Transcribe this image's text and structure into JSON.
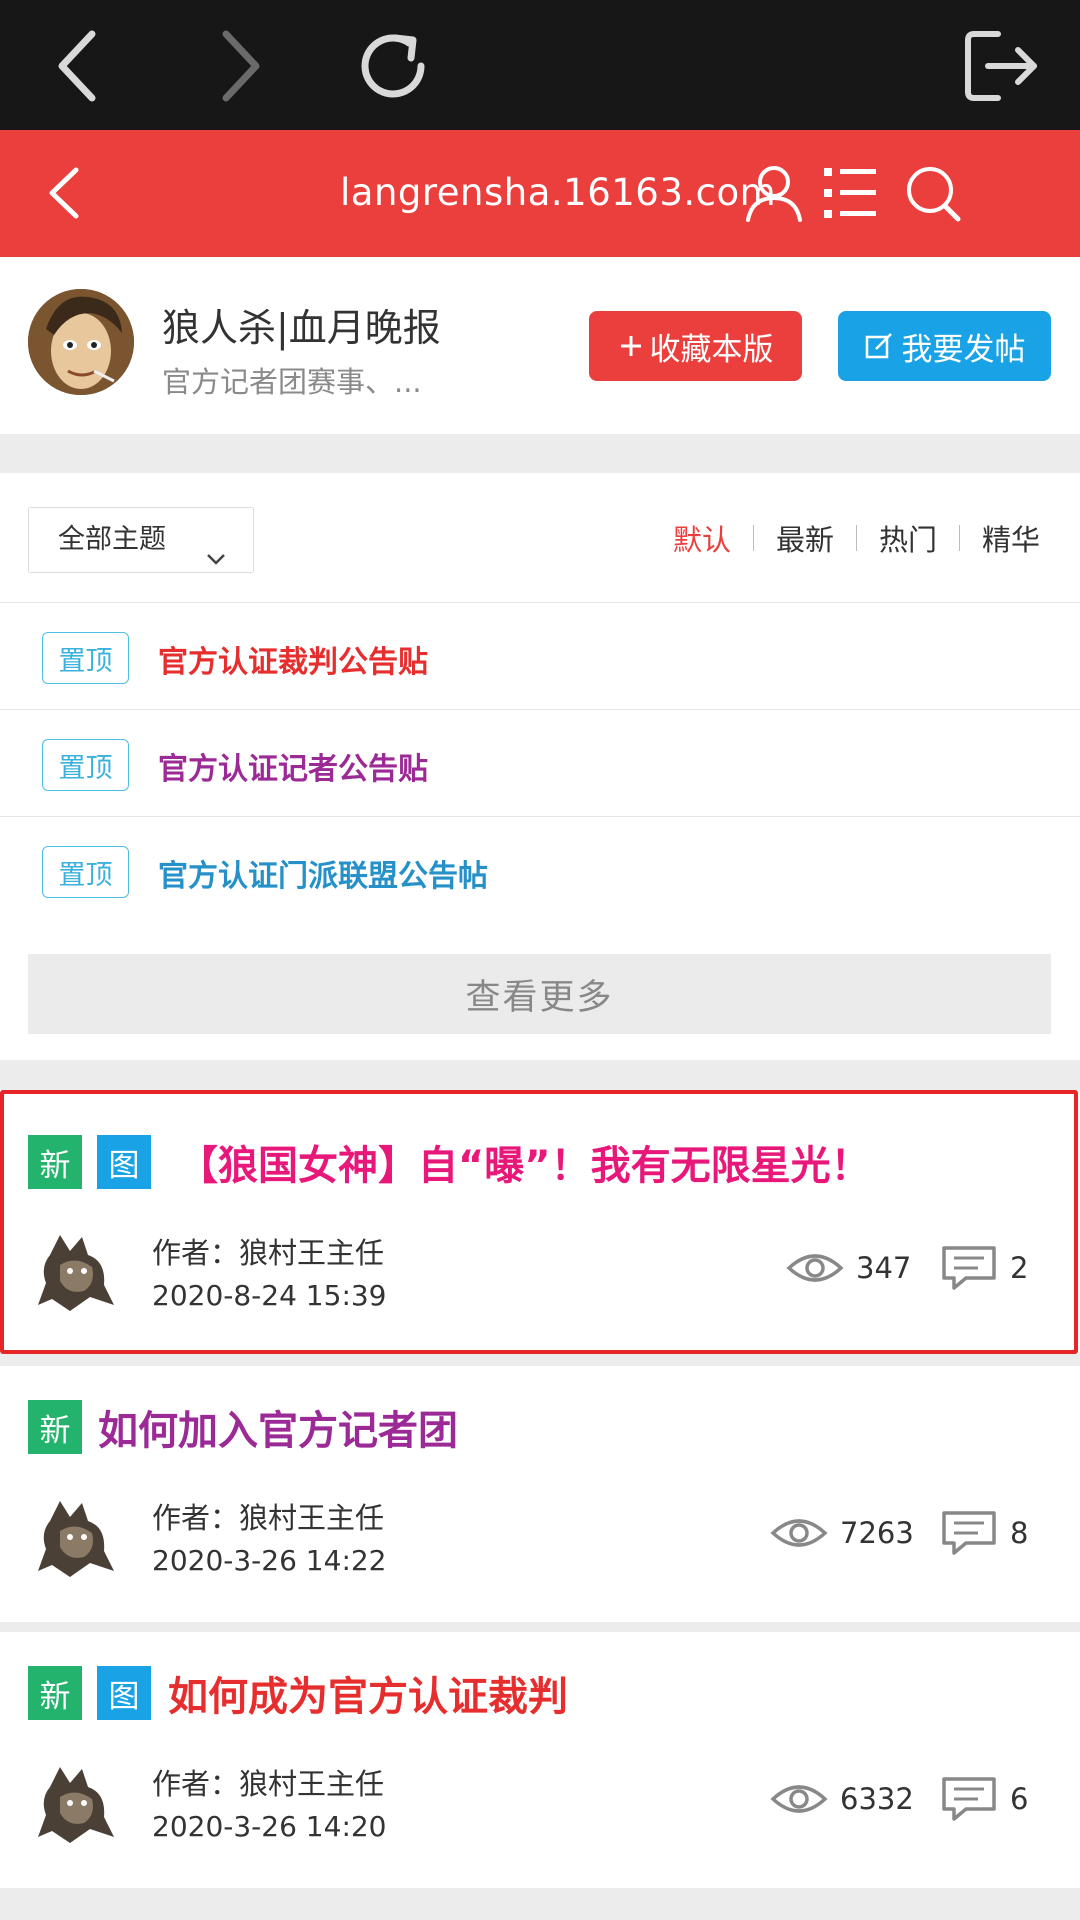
{
  "header": {
    "url": "langrensha.16163.com"
  },
  "forum": {
    "title": "狼人杀|血月晚报",
    "description": "官方记者团赛事、...",
    "favorite_label": "收藏本版",
    "post_label": "我要发帖"
  },
  "filter": {
    "selected_topic": "全部主题",
    "sort_tabs": [
      "默认",
      "最新",
      "热门",
      "精华"
    ],
    "active_sort": "默认"
  },
  "pinned": [
    {
      "badge": "置顶",
      "title": "官方认证裁判公告贴",
      "color": "#e62e2e"
    },
    {
      "badge": "置顶",
      "title": "官方认证记者公告贴",
      "color": "#9b2a96"
    },
    {
      "badge": "置顶",
      "title": "官方认证门派联盟公告帖",
      "color": "#2591c8"
    }
  ],
  "view_more_label": "查看更多",
  "posts": [
    {
      "tags": [
        "新",
        "图"
      ],
      "title": "【狼国女神】自“曝”！我有无限星光！",
      "title_color": "#e8187a",
      "author": "作者：狼村王主任",
      "date": "2020-8-24 15:39",
      "views": "347",
      "comments": "2"
    },
    {
      "tags": [
        "新"
      ],
      "title": "如何加入官方记者团",
      "title_color": "#9b2a96",
      "author": "作者：狼村王主任",
      "date": "2020-3-26 14:22",
      "views": "7263",
      "comments": "8"
    },
    {
      "tags": [
        "新",
        "图"
      ],
      "title": "如何成为官方认证裁判",
      "title_color": "#e62e2e",
      "author": "作者：狼村王主任",
      "date": "2020-3-26 14:20",
      "views": "6332",
      "comments": "6"
    }
  ],
  "colors": {
    "brand_red": "#ea3f3d",
    "brand_blue": "#19a3e6",
    "tag_green": "#23b36d"
  }
}
